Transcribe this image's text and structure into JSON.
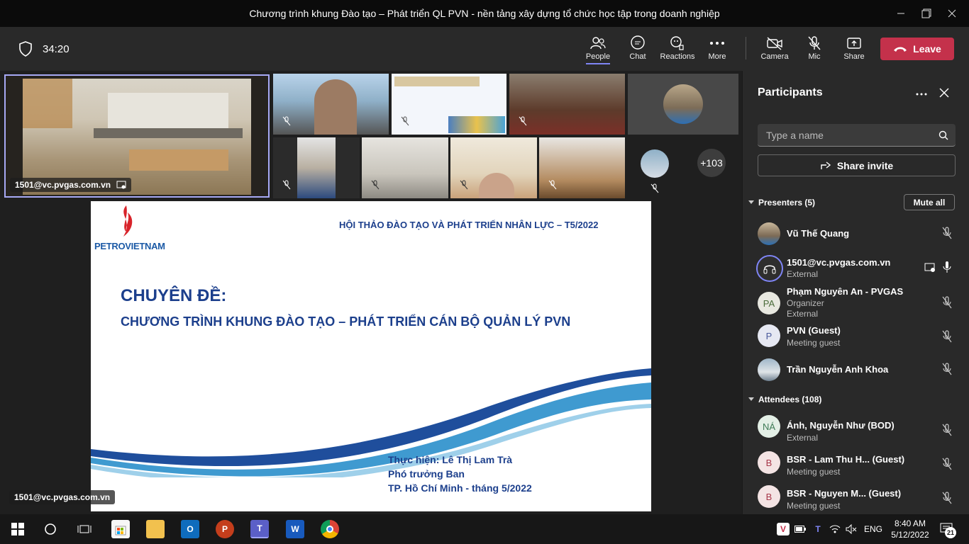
{
  "window": {
    "title": "Chương trình khung Đào tạo – Phát triển QL PVN - nền tảng xây dựng tổ chức học tập trong doanh nghiệp"
  },
  "meeting": {
    "timer": "34:20"
  },
  "toolbar": {
    "people": "People",
    "chat": "Chat",
    "reactions": "Reactions",
    "more": "More",
    "camera": "Camera",
    "mic": "Mic",
    "share": "Share",
    "leave": "Leave"
  },
  "stage": {
    "main_tile_name": "1501@vc.pvgas.com.vn",
    "overflow_count": "+103",
    "presenter_tag": "1501@vc.pvgas.com.vn"
  },
  "slide": {
    "brand": "PETROVIETNAM",
    "header": "HỘI THẢO ĐÀO TẠO VÀ PHÁT TRIỂN NHÂN LỰC – T5/2022",
    "topic_label": "CHUYÊN ĐỀ:",
    "topic_title": "CHƯƠNG TRÌNH KHUNG ĐÀO TẠO – PHÁT TRIỂN CÁN BỘ QUẢN LÝ PVN",
    "presenter_line": "Thực hiện: Lê Thị Lam Trà",
    "position_line": "Phó trưởng Ban",
    "place_line": "TP. Hồ Chí Minh - tháng 5/2022"
  },
  "panel": {
    "title": "Participants",
    "search_placeholder": "Type a name",
    "share_invite": "Share invite",
    "presenters_label": "Presenters (5)",
    "mute_all": "Mute all",
    "attendees_label": "Attendees (108)",
    "presenters": [
      {
        "name": "Vũ Thế Quang",
        "sub": "",
        "sub2": "",
        "initials": ""
      },
      {
        "name": "1501@vc.pvgas.com.vn",
        "sub": "External",
        "sub2": "",
        "initials": ""
      },
      {
        "name": "Phạm Nguyên An - PVGAS",
        "sub": "Organizer",
        "sub2": "External",
        "initials": "PA"
      },
      {
        "name": "PVN (Guest)",
        "sub": "Meeting guest",
        "sub2": "",
        "initials": "P"
      },
      {
        "name": "Trần Nguyễn Anh Khoa",
        "sub": "",
        "sub2": "",
        "initials": ""
      }
    ],
    "attendees": [
      {
        "name": "Ánh, Nguyễn Như (BOD)",
        "sub": "External",
        "initials": "NÁ"
      },
      {
        "name": "BSR - Lam Thu H... (Guest)",
        "sub": "Meeting guest",
        "initials": "B"
      },
      {
        "name": "BSR - Nguyen M... (Guest)",
        "sub": "Meeting guest",
        "initials": "B"
      }
    ]
  },
  "taskbar": {
    "language": "ENG",
    "time": "8:40 AM",
    "date": "5/12/2022",
    "notifications": "21"
  },
  "colors": {
    "leave": "#c4314b",
    "accent": "#7f85f5",
    "slide_blue": "#1c3f8c"
  }
}
